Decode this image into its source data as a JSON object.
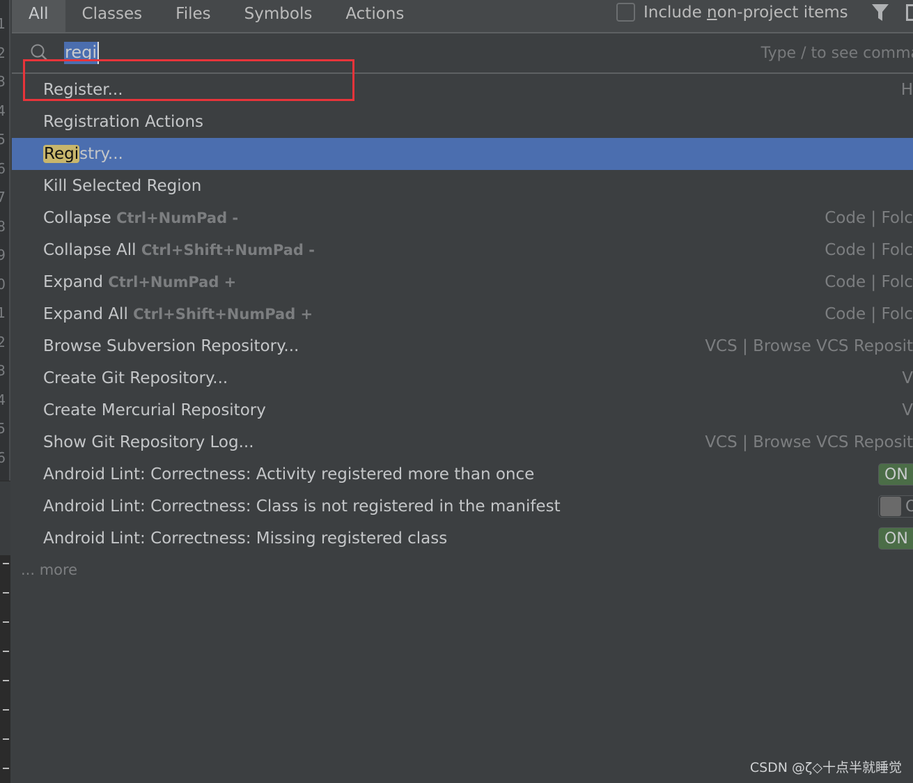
{
  "gutter_digits": [
    "1",
    "2",
    "3",
    "4",
    "5",
    "6",
    "7",
    "8",
    "9",
    "0",
    "1",
    "2",
    "3",
    "4",
    "5",
    "6"
  ],
  "tabs": [
    {
      "label": "All",
      "active": true
    },
    {
      "label": "Classes"
    },
    {
      "label": "Files"
    },
    {
      "label": "Symbols"
    },
    {
      "label": "Actions"
    }
  ],
  "include": {
    "pre": "Include ",
    "mnemonic": "n",
    "post": "on-project items",
    "checked": false
  },
  "icons": {
    "filter": "filter-icon",
    "pin": "pin-icon",
    "search": "search-icon"
  },
  "search": {
    "query": "regi",
    "hint": "Type / to see comma"
  },
  "items": [
    {
      "label": "Register...",
      "loc": "H"
    },
    {
      "label": "Registration Actions"
    },
    {
      "match": "Regi",
      "label": "stry...",
      "selected": true
    },
    {
      "label": "Kill Selected Region"
    },
    {
      "label": "Collapse ",
      "shortcut": "Ctrl+NumPad -",
      "loc": "Code | Folc"
    },
    {
      "label": "Collapse All ",
      "shortcut": "Ctrl+Shift+NumPad -",
      "loc": "Code | Folc"
    },
    {
      "label": "Expand ",
      "shortcut": "Ctrl+NumPad +",
      "loc": "Code | Folc"
    },
    {
      "label": "Expand All ",
      "shortcut": "Ctrl+Shift+NumPad +",
      "loc": "Code | Folc"
    },
    {
      "label": "Browse Subversion Repository...",
      "loc": "VCS | Browse VCS Reposit"
    },
    {
      "label": "Create Git Repository...",
      "loc": "V"
    },
    {
      "label": "Create Mercurial Repository",
      "loc": "V"
    },
    {
      "label": "Show Git Repository Log...",
      "loc": "VCS | Browse VCS Reposit"
    },
    {
      "label": "Android Lint: Correctness: Activity registered more than once",
      "toggle": "ON"
    },
    {
      "label": "Android Lint: Correctness: Class is not registered in the manifest",
      "toggle": "OFF",
      "toggle_text": "O"
    },
    {
      "label": "Android Lint: Correctness: Missing registered class",
      "toggle": "ON"
    }
  ],
  "more": "... more",
  "watermark": "CSDN @ζ◇十点半就睡觉",
  "colors": {
    "selection": "#4b6eaf",
    "match_highlight": "#c8b66c",
    "annotation_box": "#e8343a",
    "toggle_on": "#4b6d47"
  }
}
